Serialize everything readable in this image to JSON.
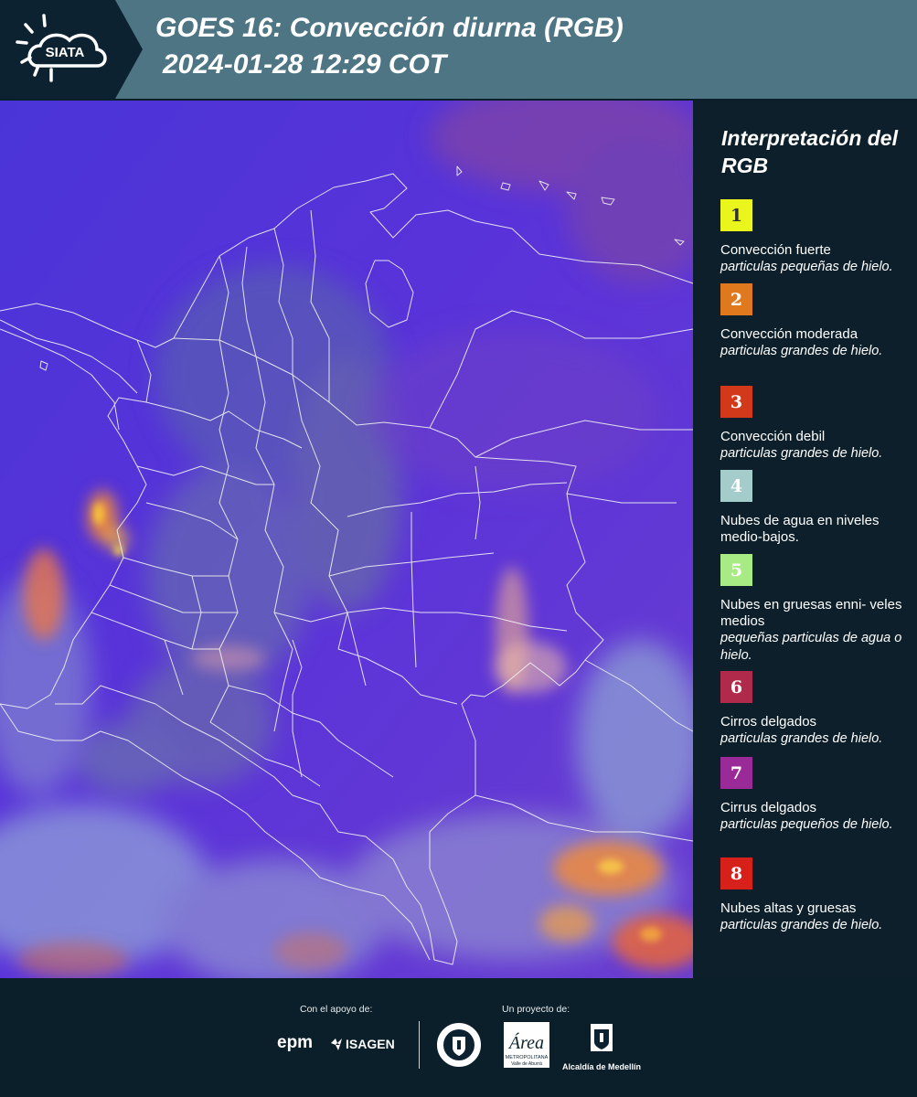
{
  "header": {
    "logo_text": "SIATA",
    "title_line1": "GOES 16: Convección diurna (RGB)",
    "title_line2": "2024-01-28 12:29 COT"
  },
  "legend": {
    "title": "Interpretación del RGB",
    "items": [
      {
        "num": "1",
        "color": "#eaf51c",
        "text_color": "#333333",
        "title": "Convección fuerte",
        "sub": "particulas pequeñas de hielo."
      },
      {
        "num": "2",
        "color": "#e0781e",
        "text_color": "#ffffff",
        "title": "Convección moderada",
        "sub": "particulas grandes de hielo."
      },
      {
        "num": "3",
        "color": "#d2381a",
        "text_color": "#ffffff",
        "title": "Convección debil",
        "sub": "particulas grandes de hielo."
      },
      {
        "num": "4",
        "color": "#a4cccb",
        "text_color": "#ffffff",
        "title": "Nubes de agua en niveles medio-bajos.",
        "sub": ""
      },
      {
        "num": "5",
        "color": "#a8ea83",
        "text_color": "#ffffff",
        "title": "Nubes en gruesas enni- veles medios",
        "sub": "pequeñas particulas de agua o hielo."
      },
      {
        "num": "6",
        "color": "#b02b4b",
        "text_color": "#ffffff",
        "title": "Cirros delgados",
        "sub": "particulas grandes de hielo."
      },
      {
        "num": "7",
        "color": "#992a98",
        "text_color": "#ffffff",
        "title": "Cirrus delgados",
        "sub": "particulas pequeños de hielo."
      },
      {
        "num": "8",
        "color": "#d8201a",
        "text_color": "#ffffff",
        "title": "Nubes altas y gruesas",
        "sub": "particulas grandes de hielo."
      }
    ]
  },
  "footer": {
    "support_label": "Con el apoyo de:",
    "project_label": "Un proyecto de:",
    "epm": "epm",
    "isagen": "ISAGEN",
    "metro_line1": "METROPOLITANA",
    "metro_line2": "Valle de Aburrá",
    "alcaldia": "Alcaldía de Medellín"
  },
  "colors": {
    "header_bg": "#4e7583",
    "logo_bg": "#0d2230",
    "page_bg": "#0b1f2a",
    "map_base": "#5a36d6",
    "border_lines": "#f2f2f2"
  }
}
